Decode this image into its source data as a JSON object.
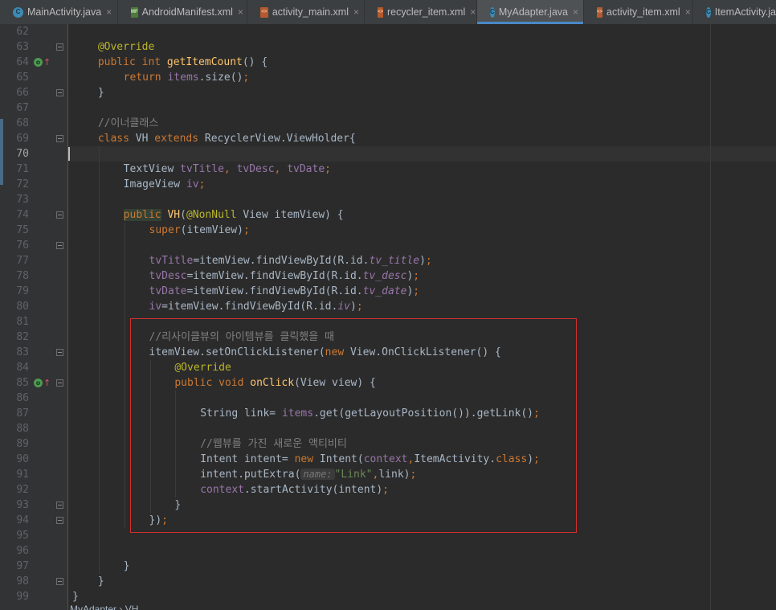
{
  "tabs": [
    {
      "label": "MainActivity.java",
      "icon": "class-icon",
      "icon_glyph": "C",
      "close": "×",
      "active": false
    },
    {
      "label": "AndroidManifest.xml",
      "icon": "manifest-icon",
      "icon_glyph": "MF",
      "close": "×",
      "active": false
    },
    {
      "label": "activity_main.xml",
      "icon": "layout-icon",
      "icon_glyph": "<>",
      "close": "×",
      "active": false
    },
    {
      "label": "recycler_item.xml",
      "icon": "layout-icon",
      "icon_glyph": "<>",
      "close": "×",
      "active": false
    },
    {
      "label": "MyAdapter.java",
      "icon": "class-icon",
      "icon_glyph": "C",
      "close": "×",
      "active": true
    },
    {
      "label": "activity_item.xml",
      "icon": "layout-icon",
      "icon_glyph": "<>",
      "close": "×",
      "active": false
    },
    {
      "label": "ItemActivity.java",
      "icon": "class-icon",
      "icon_glyph": "C",
      "close": "",
      "active": false
    }
  ],
  "editor": {
    "current_line": 70,
    "override_gutter_lines": [
      64,
      85
    ],
    "override_glyph": "o",
    "override_arrow": "↑",
    "fold_lines": [
      63,
      66,
      69,
      74,
      76,
      83,
      85,
      93,
      94,
      98
    ],
    "lines": [
      {
        "n": 62,
        "indent": 0,
        "tokens": []
      },
      {
        "n": 63,
        "indent": 4,
        "tokens": [
          {
            "t": "@Override",
            "c": "ann"
          }
        ]
      },
      {
        "n": 64,
        "indent": 4,
        "tokens": [
          {
            "t": "public int ",
            "c": "kw"
          },
          {
            "t": "getItemCount",
            "c": "fn"
          },
          {
            "t": "() {",
            "c": ""
          }
        ]
      },
      {
        "n": 65,
        "indent": 8,
        "tokens": [
          {
            "t": "return ",
            "c": "kw"
          },
          {
            "t": "items",
            "c": "field"
          },
          {
            "t": ".size()",
            "c": ""
          },
          {
            "t": ";",
            "c": "kw"
          }
        ]
      },
      {
        "n": 66,
        "indent": 4,
        "tokens": [
          {
            "t": "}",
            "c": ""
          }
        ]
      },
      {
        "n": 67,
        "indent": 0,
        "tokens": []
      },
      {
        "n": 68,
        "indent": 4,
        "tokens": [
          {
            "t": "//이너클래스",
            "c": "cmt"
          }
        ]
      },
      {
        "n": 69,
        "indent": 4,
        "tokens": [
          {
            "t": "class ",
            "c": "kw"
          },
          {
            "t": "VH ",
            "c": ""
          },
          {
            "t": "extends ",
            "c": "kw"
          },
          {
            "t": "RecyclerView.ViewHolder{",
            "c": ""
          }
        ]
      },
      {
        "n": 70,
        "indent": 0,
        "tokens": []
      },
      {
        "n": 71,
        "indent": 8,
        "tokens": [
          {
            "t": "TextView ",
            "c": ""
          },
          {
            "t": "tvTitle",
            "c": "field"
          },
          {
            "t": ", ",
            "c": "kw"
          },
          {
            "t": "tvDesc",
            "c": "field"
          },
          {
            "t": ", ",
            "c": "kw"
          },
          {
            "t": "tvDate",
            "c": "field"
          },
          {
            "t": ";",
            "c": "kw"
          }
        ]
      },
      {
        "n": 72,
        "indent": 8,
        "tokens": [
          {
            "t": "ImageView ",
            "c": ""
          },
          {
            "t": "iv",
            "c": "field"
          },
          {
            "t": ";",
            "c": "kw"
          }
        ]
      },
      {
        "n": 73,
        "indent": 0,
        "tokens": []
      },
      {
        "n": 74,
        "indent": 8,
        "tokens": [
          {
            "t": "public",
            "c": "kwbg"
          },
          {
            "t": " ",
            "c": ""
          },
          {
            "t": "VH",
            "c": "fn"
          },
          {
            "t": "(",
            "c": ""
          },
          {
            "t": "@NonNull ",
            "c": "ann"
          },
          {
            "t": "View itemView) {",
            "c": ""
          }
        ]
      },
      {
        "n": 75,
        "indent": 12,
        "tokens": [
          {
            "t": "super",
            "c": "kw"
          },
          {
            "t": "(itemView)",
            "c": ""
          },
          {
            "t": ";",
            "c": "kw"
          }
        ]
      },
      {
        "n": 76,
        "indent": 0,
        "tokens": []
      },
      {
        "n": 77,
        "indent": 12,
        "tokens": [
          {
            "t": "tvTitle",
            "c": "field"
          },
          {
            "t": "=itemView.findViewById(R.id.",
            "c": ""
          },
          {
            "t": "tv_title",
            "c": "field-it"
          },
          {
            "t": ")",
            "c": ""
          },
          {
            "t": ";",
            "c": "kw"
          }
        ]
      },
      {
        "n": 78,
        "indent": 12,
        "tokens": [
          {
            "t": "tvDesc",
            "c": "field"
          },
          {
            "t": "=itemView.findViewById(R.id.",
            "c": ""
          },
          {
            "t": "tv_desc",
            "c": "field-it"
          },
          {
            "t": ")",
            "c": ""
          },
          {
            "t": ";",
            "c": "kw"
          }
        ]
      },
      {
        "n": 79,
        "indent": 12,
        "tokens": [
          {
            "t": "tvDate",
            "c": "field"
          },
          {
            "t": "=itemView.findViewById(R.id.",
            "c": ""
          },
          {
            "t": "tv_date",
            "c": "field-it"
          },
          {
            "t": ")",
            "c": ""
          },
          {
            "t": ";",
            "c": "kw"
          }
        ]
      },
      {
        "n": 80,
        "indent": 12,
        "tokens": [
          {
            "t": "iv",
            "c": "field"
          },
          {
            "t": "=itemView.findViewById(R.id.",
            "c": ""
          },
          {
            "t": "iv",
            "c": "field-it"
          },
          {
            "t": ")",
            "c": ""
          },
          {
            "t": ";",
            "c": "kw"
          }
        ]
      },
      {
        "n": 81,
        "indent": 0,
        "tokens": []
      },
      {
        "n": 82,
        "indent": 12,
        "tokens": [
          {
            "t": "//리사이클뷰의 아이템뷰를 클릭했을 때",
            "c": "cmt"
          }
        ]
      },
      {
        "n": 83,
        "indent": 12,
        "tokens": [
          {
            "t": "itemView.setOnClickListener(",
            "c": ""
          },
          {
            "t": "new ",
            "c": "kw"
          },
          {
            "t": "View.OnClickListener() {",
            "c": ""
          }
        ]
      },
      {
        "n": 84,
        "indent": 16,
        "tokens": [
          {
            "t": "@Override",
            "c": "ann"
          }
        ]
      },
      {
        "n": 85,
        "indent": 16,
        "tokens": [
          {
            "t": "public void ",
            "c": "kw"
          },
          {
            "t": "onClick",
            "c": "fn"
          },
          {
            "t": "(View view) {",
            "c": ""
          }
        ]
      },
      {
        "n": 86,
        "indent": 0,
        "tokens": []
      },
      {
        "n": 87,
        "indent": 20,
        "tokens": [
          {
            "t": "String link= ",
            "c": ""
          },
          {
            "t": "items",
            "c": "field"
          },
          {
            "t": ".get(getLayoutPosition()).getLink()",
            "c": ""
          },
          {
            "t": ";",
            "c": "kw"
          }
        ]
      },
      {
        "n": 88,
        "indent": 0,
        "tokens": []
      },
      {
        "n": 89,
        "indent": 20,
        "tokens": [
          {
            "t": "//웹뷰를 가진 새로운 액티비티",
            "c": "cmt"
          }
        ]
      },
      {
        "n": 90,
        "indent": 20,
        "tokens": [
          {
            "t": "Intent intent= ",
            "c": ""
          },
          {
            "t": "new ",
            "c": "kw"
          },
          {
            "t": "Intent(",
            "c": ""
          },
          {
            "t": "context",
            "c": "field"
          },
          {
            "t": ",",
            "c": "kw"
          },
          {
            "t": "ItemActivity.",
            "c": ""
          },
          {
            "t": "class",
            "c": "kw"
          },
          {
            "t": ")",
            "c": ""
          },
          {
            "t": ";",
            "c": "kw"
          }
        ]
      },
      {
        "n": 91,
        "indent": 20,
        "tokens": [
          {
            "t": "intent.putExtra(",
            "c": ""
          },
          {
            "t": "name:",
            "c": "hint"
          },
          {
            "t": "\"Link\"",
            "c": "str"
          },
          {
            "t": ",",
            "c": "kw"
          },
          {
            "t": "link)",
            "c": ""
          },
          {
            "t": ";",
            "c": "kw"
          }
        ]
      },
      {
        "n": 92,
        "indent": 20,
        "tokens": [
          {
            "t": "context",
            "c": "field"
          },
          {
            "t": ".startActivity(intent)",
            "c": ""
          },
          {
            "t": ";",
            "c": "kw"
          }
        ]
      },
      {
        "n": 93,
        "indent": 16,
        "tokens": [
          {
            "t": "}",
            "c": ""
          }
        ]
      },
      {
        "n": 94,
        "indent": 12,
        "tokens": [
          {
            "t": "})",
            "c": ""
          },
          {
            "t": ";",
            "c": "kw"
          }
        ]
      },
      {
        "n": 95,
        "indent": 0,
        "tokens": []
      },
      {
        "n": 96,
        "indent": 0,
        "tokens": []
      },
      {
        "n": 97,
        "indent": 8,
        "tokens": [
          {
            "t": "}",
            "c": ""
          }
        ]
      },
      {
        "n": 98,
        "indent": 4,
        "tokens": [
          {
            "t": "}",
            "c": ""
          }
        ]
      },
      {
        "n": 99,
        "indent": 0,
        "tokens": [
          {
            "t": "}",
            "c": ""
          }
        ]
      }
    ]
  },
  "breadcrumb": {
    "text": "MyAdapter › VH"
  },
  "colors": {
    "background": "#2b2b2b",
    "gutter": "#313335",
    "keyword": "#cc7832",
    "annotation": "#bbb529",
    "function": "#ffc66d",
    "field": "#9876aa",
    "comment": "#808080",
    "string": "#6a8759",
    "highlight_box": "#d32f2f",
    "active_tab_underline": "#4a88c7"
  }
}
